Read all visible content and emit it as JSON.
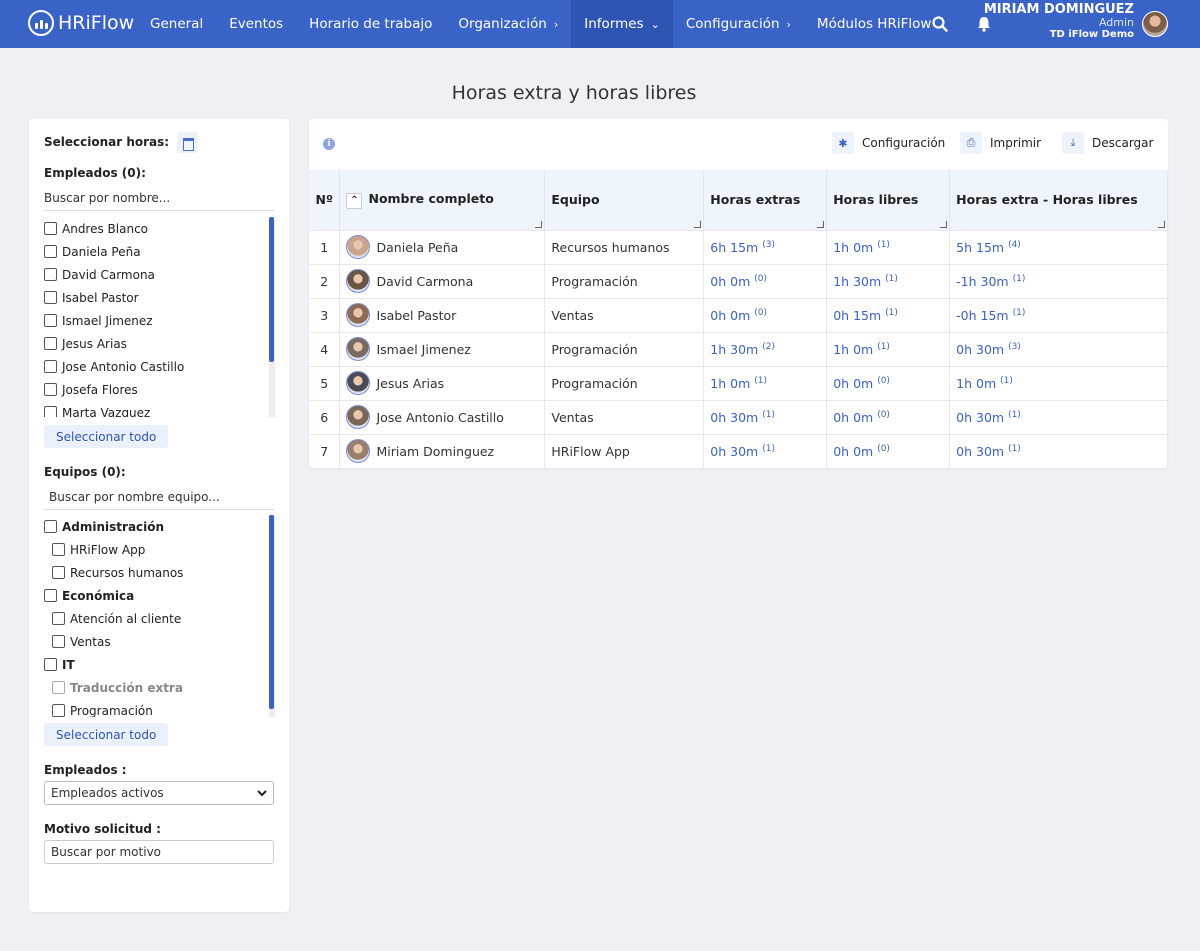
{
  "topbar": {
    "brand": "HRiFlow",
    "nav": [
      {
        "label": "General",
        "chevron": ""
      },
      {
        "label": "Eventos",
        "chevron": ""
      },
      {
        "label": "Horario de trabajo",
        "chevron": ""
      },
      {
        "label": "Organización",
        "chevron": "›"
      },
      {
        "label": "Informes",
        "chevron": "⌄"
      },
      {
        "label": "Configuración",
        "chevron": "›"
      },
      {
        "label": "Módulos HRiFlow",
        "chevron": ""
      }
    ],
    "user": {
      "name": "MIRIAM DOMINGUEZ",
      "role": "Admin",
      "org": "TD iFlow Demo"
    }
  },
  "page_title": "Horas extra y horas libres",
  "filters": {
    "hours_label": "Seleccionar horas:",
    "employees_label": "Empleados (0):",
    "employee_search_placeholder": "Buscar por nombre...",
    "employees": [
      "Andres Blanco",
      "Daniela Peña",
      "David Carmona",
      "Isabel Pastor",
      "Ismael Jimenez",
      "Jesus Arias",
      "Jose Antonio Castillo",
      "Josefa Flores",
      "Marta Vazquez"
    ],
    "select_all": "Seleccionar todo",
    "teams_label": "Equipos (0):",
    "team_search_placeholder": "Buscar por nombre equipo...",
    "teams": [
      {
        "label": "Administración",
        "level": 0,
        "disabled": false
      },
      {
        "label": "HRiFlow App",
        "level": 1,
        "disabled": false
      },
      {
        "label": "Recursos humanos",
        "level": 1,
        "disabled": false
      },
      {
        "label": "Económica",
        "level": 0,
        "disabled": false
      },
      {
        "label": "Atención al cliente",
        "level": 1,
        "disabled": false
      },
      {
        "label": "Ventas",
        "level": 1,
        "disabled": false
      },
      {
        "label": "IT",
        "level": 0,
        "disabled": false
      },
      {
        "label": "Traducción extra",
        "level": 1,
        "disabled": true
      },
      {
        "label": "Programación",
        "level": 1,
        "disabled": false
      }
    ],
    "employee_status_label": "Empleados :",
    "employee_status_value": "Empleados activos",
    "reason_label": "Motivo solicitud :",
    "reason_placeholder": "Buscar por motivo"
  },
  "toolbar": {
    "config": "Configuración",
    "print": "Imprimir",
    "download": "Descargar"
  },
  "table": {
    "headers": [
      "Nº",
      "Nombre completo",
      "Equipo",
      "Horas extras",
      "Horas libres",
      "Horas extra - Horas libres"
    ],
    "rows": [
      {
        "n": "1",
        "name": "Daniela Peña",
        "team": "Recursos humanos",
        "extra": "6h 15m",
        "extra_c": "(3)",
        "free": "1h 0m",
        "free_c": "(1)",
        "diff": "5h 15m",
        "diff_c": "(4)"
      },
      {
        "n": "2",
        "name": "David Carmona",
        "team": "Programación",
        "extra": "0h 0m",
        "extra_c": "(0)",
        "free": "1h 30m",
        "free_c": "(1)",
        "diff": "-1h 30m",
        "diff_c": "(1)"
      },
      {
        "n": "3",
        "name": "Isabel Pastor",
        "team": "Ventas",
        "extra": "0h 0m",
        "extra_c": "(0)",
        "free": "0h 15m",
        "free_c": "(1)",
        "diff": "-0h 15m",
        "diff_c": "(1)"
      },
      {
        "n": "4",
        "name": "Ismael Jimenez",
        "team": "Programación",
        "extra": "1h 30m",
        "extra_c": "(2)",
        "free": "1h 0m",
        "free_c": "(1)",
        "diff": "0h 30m",
        "diff_c": "(3)"
      },
      {
        "n": "5",
        "name": "Jesus Arias",
        "team": "Programación",
        "extra": "1h 0m",
        "extra_c": "(1)",
        "free": "0h 0m",
        "free_c": "(0)",
        "diff": "1h 0m",
        "diff_c": "(1)"
      },
      {
        "n": "6",
        "name": "Jose Antonio Castillo",
        "team": "Ventas",
        "extra": "0h 30m",
        "extra_c": "(1)",
        "free": "0h 0m",
        "free_c": "(0)",
        "diff": "0h 30m",
        "diff_c": "(1)"
      },
      {
        "n": "7",
        "name": "Miriam Dominguez",
        "team": "HRiFlow App",
        "extra": "0h 30m",
        "extra_c": "(1)",
        "free": "0h 0m",
        "free_c": "(0)",
        "diff": "0h 30m",
        "diff_c": "(1)"
      }
    ]
  }
}
